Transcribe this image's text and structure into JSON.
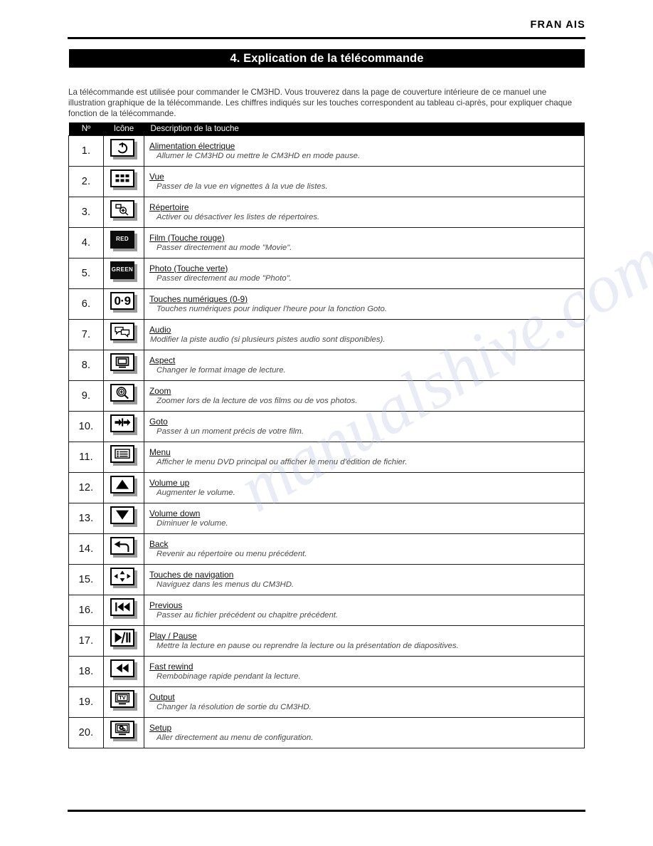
{
  "header": {
    "language": "FRAN  AIS"
  },
  "section": {
    "title": "4. Explication de la télécommande"
  },
  "intro": {
    "text": "La télécommande est utilisée pour commander le CM3HD. Vous trouverez dans la page de couverture intérieure de ce manuel une illustration graphique de la télécommande. Les chiffres indiqués sur les touches correspondent au tableau ci-après, pour expliquer chaque fonction de la télécommande."
  },
  "table": {
    "columns": [
      "Nº",
      "Icône",
      "Description de la touche"
    ],
    "rows": [
      {
        "num": "1.",
        "icon": "power-icon",
        "label": "Alimentation électrique",
        "sub": "Allumer le CM3HD ou mettre le CM3HD en mode pause."
      },
      {
        "num": "2.",
        "icon": "grid-view-icon",
        "label": "Vue",
        "sub": "Passer de la vue en vignettes à la vue de listes."
      },
      {
        "num": "3.",
        "icon": "directory-icon",
        "label": "Répertoire",
        "sub": "Activer ou désactiver les listes de répertoires."
      },
      {
        "num": "4.",
        "icon": "red-button-icon",
        "label": "Film (Touche rouge)",
        "sub": "Passer directement au mode \"Movie\"."
      },
      {
        "num": "5.",
        "icon": "green-button-icon",
        "label": "Photo (Touche verte)",
        "sub": "Passer directement au mode \"Photo\"."
      },
      {
        "num": "6.",
        "icon": "numeric-keys-icon",
        "label": "Touches numériques (0-9)",
        "sub": "Touches numériques pour indiquer l'heure pour la fonction Goto."
      },
      {
        "num": "7.",
        "icon": "audio-icon",
        "label": "Audio",
        "sub": "Modifier la piste audio (si plusieurs pistes audio sont disponibles)."
      },
      {
        "num": "8.",
        "icon": "aspect-icon",
        "label": "Aspect",
        "sub": "Changer le format image de lecture."
      },
      {
        "num": "9.",
        "icon": "zoom-icon",
        "label": "Zoom",
        "sub": "Zoomer lors de la lecture de vos films ou de vos photos."
      },
      {
        "num": "10.",
        "icon": "goto-icon",
        "label": "Goto",
        "sub": "Passer à un moment précis de votre film."
      },
      {
        "num": "11.",
        "icon": "menu-icon",
        "label": "Menu",
        "sub": "Afficher le menu DVD principal ou afficher le menu d'édition de fichier."
      },
      {
        "num": "12.",
        "icon": "volume-up-icon",
        "label": "Volume up",
        "sub": "Augmenter le volume."
      },
      {
        "num": "13.",
        "icon": "volume-down-icon",
        "label": "Volume down",
        "sub": "Diminuer le volume."
      },
      {
        "num": "14.",
        "icon": "back-arrow-icon",
        "label": "Back",
        "sub": "Revenir au répertoire ou menu précédent."
      },
      {
        "num": "15.",
        "icon": "navigation-keys-icon",
        "label": "Touches de navigation",
        "sub": "Naviguez dans les menus du CM3HD."
      },
      {
        "num": "16.",
        "icon": "previous-icon",
        "label": "Previous",
        "sub": "Passer au fichier précédent ou chapitre précédent."
      },
      {
        "num": "17.",
        "icon": "play-pause-icon",
        "label": "Play / Pause",
        "sub": "Mettre la lecture en pause ou reprendre la lecture ou la présentation de diapositives."
      },
      {
        "num": "18.",
        "icon": "fast-rewind-icon",
        "label": "Fast rewind",
        "sub": "Rembobinage rapide pendant la lecture."
      },
      {
        "num": "19.",
        "icon": "tv-output-icon",
        "label": "Output",
        "sub": "Changer la résolution de sortie du CM3HD."
      },
      {
        "num": "20.",
        "icon": "setup-icon",
        "label": "Setup",
        "sub": "Aller directement au menu de configuration."
      }
    ],
    "icon_texts": {
      "red": "RED",
      "green": "GREEN",
      "numeric": "0·9",
      "tv": "TV"
    }
  },
  "watermark": {
    "text": "manualshive.com"
  },
  "colors": {
    "bar_background": "#000000",
    "bar_text": "#ffffff",
    "body_text": "#3a3a3a",
    "italic_text": "#4a4a4a",
    "icon_shadow": "#9a9a9a",
    "watermark": "#b9bfe0"
  }
}
